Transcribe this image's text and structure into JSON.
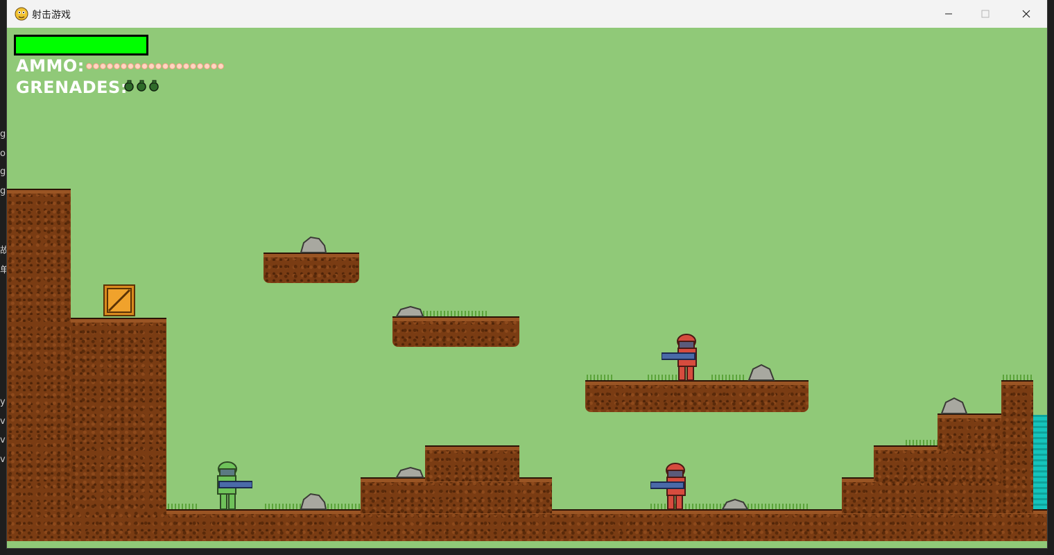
{
  "window": {
    "title": "射击游戏"
  },
  "hud": {
    "health": 1.0,
    "ammo_label": "AMMO:",
    "ammo_count": 20,
    "grenades_label": "GRENADES:",
    "grenade_count": 3
  },
  "icons": {
    "app": "python-snake-icon",
    "minimize": "minimize-icon",
    "maximize": "maximize-icon",
    "close": "close-icon"
  },
  "colors": {
    "sky": "#90c978",
    "health": "#00ff00",
    "dirt": "#7a3c13",
    "water": "#12b8b0",
    "player": "#6fc25a",
    "enemy": "#d64c3e"
  },
  "entities": {
    "player": {
      "team": "player",
      "facing": "right"
    },
    "enemies": [
      {
        "facing": "left"
      },
      {
        "facing": "left"
      }
    ],
    "crate": {
      "type": "item-box"
    }
  }
}
